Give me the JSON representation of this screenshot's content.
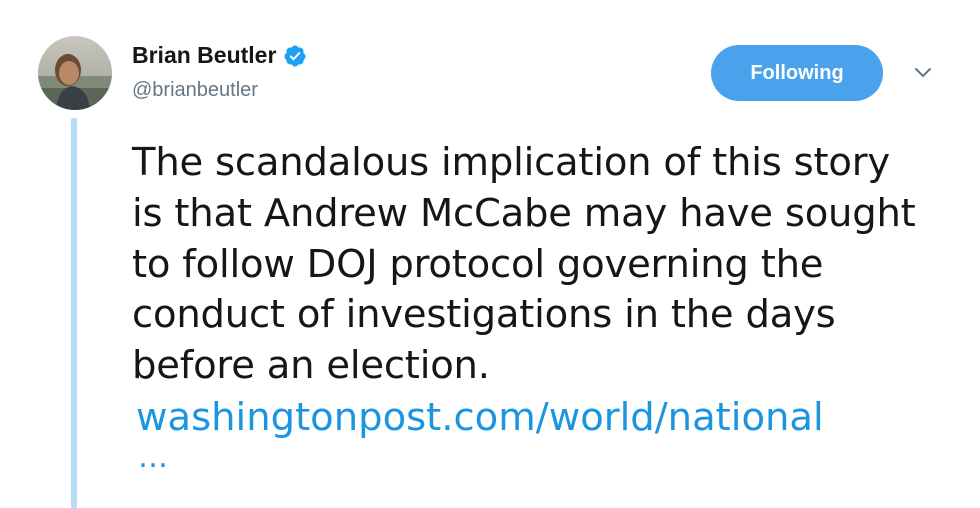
{
  "author": {
    "display_name": "Brian Beutler",
    "handle": "@brianbeutler",
    "verified": true,
    "avatar_icon": "user-avatar-photo"
  },
  "follow_button": {
    "label": "Following"
  },
  "menu": {
    "icon": "chevron-down-icon"
  },
  "tweet": {
    "lines": [
      "The scandalous implication of this story",
      "is that Andrew McCabe may have sought",
      "to follow DOJ protocol governing the",
      "conduct of investigations in the days",
      "before an election."
    ],
    "link_text": "washingtonpost.com/world/national",
    "link_ellipsis": "…"
  },
  "colors": {
    "accent": "#1b95e0",
    "button_bg": "#4aa1ec",
    "thread_line": "#b7dcf6",
    "text": "#14171a",
    "muted": "#657786"
  }
}
